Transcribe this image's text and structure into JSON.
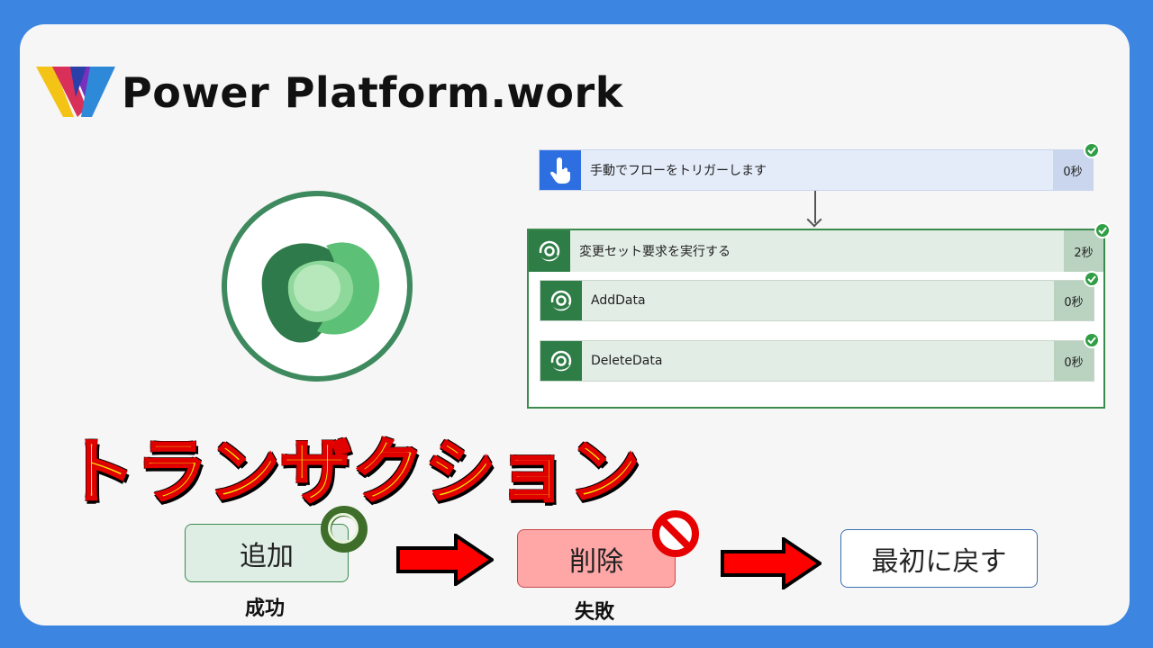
{
  "brand": {
    "name": "Power Platform.work"
  },
  "flow": {
    "trigger": {
      "label": "手動でフローをトリガーします",
      "duration": "0秒",
      "icon": "touch-icon"
    },
    "scope": {
      "label": "変更セット要求を実行する",
      "duration": "2秒",
      "icon": "dataverse-icon"
    },
    "actions": [
      {
        "label": "AddData",
        "duration": "0秒",
        "icon": "dataverse-icon"
      },
      {
        "label": "DeleteData",
        "duration": "0秒",
        "icon": "dataverse-icon"
      }
    ]
  },
  "title": "トランザクション",
  "sequence": {
    "add": {
      "label": "追加",
      "caption": "成功"
    },
    "delete": {
      "label": "削除",
      "caption": "失敗"
    },
    "reset": {
      "label": "最初に戻す"
    }
  },
  "colors": {
    "frame": "#3c85e0",
    "dataverse": "#2e7d47",
    "trigger": "#2d6ee0",
    "titleFill": "#f4f000",
    "titleStroke": "#e00000"
  }
}
